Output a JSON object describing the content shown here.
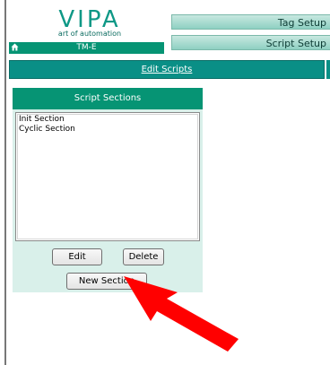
{
  "brand": {
    "name": "VIPA",
    "tagline": "art of automation",
    "accent": "#0e9886"
  },
  "header": {
    "device_label": "TM-E"
  },
  "tabs": {
    "tag_setup": "Tag Setup",
    "script_setup": "Script Setup"
  },
  "edit_scripts": {
    "link": "Edit Scripts"
  },
  "script_sections": {
    "title": "Script Sections",
    "items": [
      "Init Section",
      "Cyclic Section"
    ]
  },
  "buttons": {
    "edit": "Edit",
    "delete": "Delete",
    "new_section": "New Section"
  },
  "icons": {
    "home": "home-icon",
    "callout": "red-arrow-icon"
  },
  "colors": {
    "header_green": "#069474",
    "panel_bg": "#d9f0ea",
    "arrow": "#ff0000"
  }
}
